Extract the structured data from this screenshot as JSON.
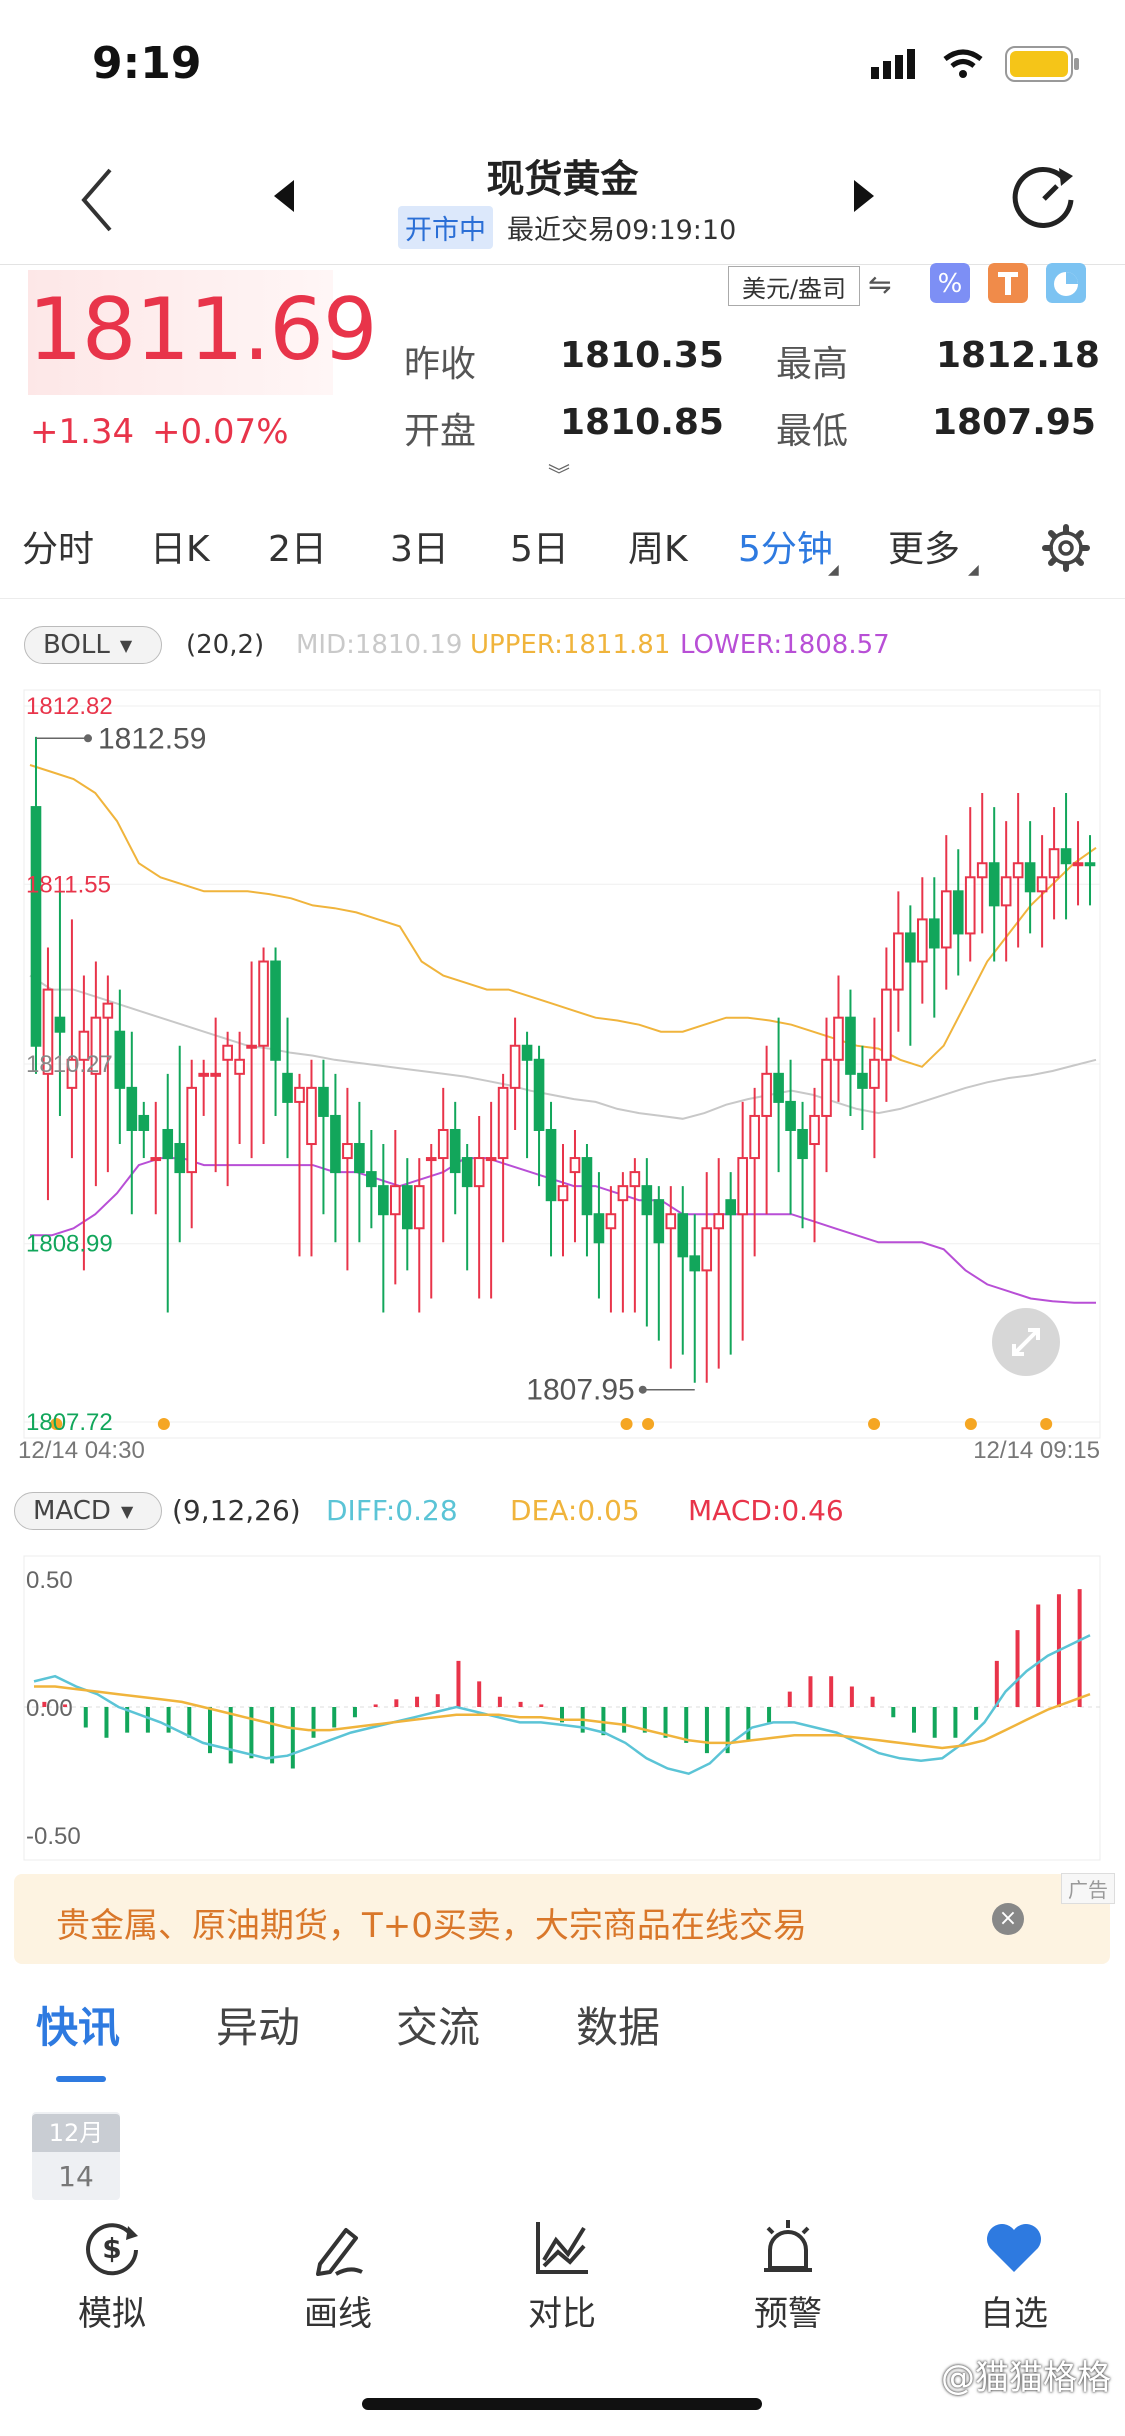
{
  "status": {
    "time": "9:19"
  },
  "header": {
    "title": "现货黄金",
    "status_badge": "开市中",
    "last_trade": "最近交易09:19:10"
  },
  "quote": {
    "price": "1811.69",
    "change": "+1.34",
    "change_pct": "+0.07%",
    "currency": "美元/盎司",
    "stats": [
      {
        "label": "昨收",
        "value": "1810.35"
      },
      {
        "label": "最高",
        "value": "1812.18"
      },
      {
        "label": "开盘",
        "value": "1810.85"
      },
      {
        "label": "最低",
        "value": "1807.95"
      }
    ]
  },
  "period_tabs": [
    "分时",
    "日K",
    "2日",
    "3日",
    "5日",
    "周K",
    "5分钟",
    "更多"
  ],
  "active_tab": "5分钟",
  "boll": {
    "name": "BOLL",
    "params": "(20,2)",
    "mid": "MID:1810.19",
    "upper": "UPPER:1811.81",
    "lower": "LOWER:1808.57"
  },
  "macd": {
    "name": "MACD",
    "params": "(9,12,26)",
    "diff": "DIFF:0.28",
    "dea": "DEA:0.05",
    "macd": "MACD:0.46"
  },
  "colors": {
    "up": "#e8344a",
    "down": "#12a65b",
    "mid_line": "#c8c8c8",
    "upper_line": "#f0b43c",
    "lower_line": "#b84fd6",
    "diff_line": "#5bc4d6",
    "dea_line": "#f0b43c",
    "accent": "#2e7ae0"
  },
  "chart_data": [
    {
      "type": "candlestick",
      "y_tick_labels": [
        "1812.82",
        "1811.55",
        "1810.27",
        "1808.99",
        "1807.72"
      ],
      "ylim": [
        1807.72,
        1812.82
      ],
      "x_start_label": "12/14 04:30",
      "x_end_label": "12/14 09:15",
      "high_label": "1812.59",
      "low_label": "1807.95",
      "candles": [
        [
          1812.1,
          1810.4,
          1810.2,
          1812.6
        ],
        [
          1810.2,
          1810.8,
          1809.3,
          1811.1
        ],
        [
          1810.6,
          1810.5,
          1809.9,
          1811.5
        ],
        [
          1810.1,
          1810.3,
          1809.6,
          1811.3
        ],
        [
          1810.3,
          1810.5,
          1808.8,
          1810.9
        ],
        [
          1810.2,
          1810.6,
          1809.4,
          1811.0
        ],
        [
          1810.6,
          1810.7,
          1809.5,
          1810.9
        ],
        [
          1810.5,
          1810.1,
          1809.7,
          1810.8
        ],
        [
          1810.1,
          1809.8,
          1809.2,
          1810.5
        ],
        [
          1809.9,
          1809.8,
          1809.6,
          1810.0
        ],
        [
          1809.6,
          1809.6,
          1809.2,
          1810.0
        ],
        [
          1809.8,
          1809.6,
          1808.5,
          1810.2
        ],
        [
          1809.7,
          1809.5,
          1809.0,
          1810.4
        ],
        [
          1809.5,
          1810.1,
          1809.1,
          1810.3
        ],
        [
          1810.2,
          1810.2,
          1809.9,
          1810.3
        ],
        [
          1810.2,
          1810.2,
          1809.5,
          1810.6
        ],
        [
          1810.3,
          1810.4,
          1809.4,
          1810.5
        ],
        [
          1810.2,
          1810.3,
          1809.7,
          1810.5
        ],
        [
          1810.4,
          1810.4,
          1809.6,
          1811.0
        ],
        [
          1810.4,
          1811.0,
          1809.7,
          1811.1
        ],
        [
          1811.0,
          1810.3,
          1809.9,
          1811.1
        ],
        [
          1810.2,
          1810.0,
          1809.6,
          1810.6
        ],
        [
          1810.0,
          1810.1,
          1808.9,
          1810.2
        ],
        [
          1809.7,
          1810.1,
          1808.9,
          1810.3
        ],
        [
          1810.1,
          1809.9,
          1809.2,
          1810.3
        ],
        [
          1809.9,
          1809.5,
          1809.0,
          1810.2
        ],
        [
          1809.6,
          1809.7,
          1808.8,
          1810.1
        ],
        [
          1809.7,
          1809.5,
          1809.0,
          1810.0
        ],
        [
          1809.5,
          1809.4,
          1809.1,
          1809.8
        ],
        [
          1809.4,
          1809.2,
          1808.5,
          1809.7
        ],
        [
          1809.2,
          1809.4,
          1808.7,
          1809.8
        ],
        [
          1809.4,
          1809.1,
          1808.8,
          1809.6
        ],
        [
          1809.1,
          1809.4,
          1808.5,
          1809.6
        ],
        [
          1809.6,
          1809.6,
          1808.6,
          1809.7
        ],
        [
          1809.6,
          1809.8,
          1809.0,
          1810.1
        ],
        [
          1809.8,
          1809.5,
          1809.2,
          1810.0
        ],
        [
          1809.6,
          1809.4,
          1808.8,
          1809.7
        ],
        [
          1809.4,
          1809.6,
          1808.6,
          1809.9
        ],
        [
          1809.6,
          1809.6,
          1808.6,
          1810.0
        ],
        [
          1809.6,
          1810.1,
          1809.0,
          1810.2
        ],
        [
          1810.1,
          1810.4,
          1809.8,
          1810.6
        ],
        [
          1810.4,
          1810.3,
          1809.6,
          1810.5
        ],
        [
          1810.3,
          1809.8,
          1809.4,
          1810.4
        ],
        [
          1809.8,
          1809.3,
          1808.9,
          1810.0
        ],
        [
          1809.3,
          1809.4,
          1808.9,
          1809.7
        ],
        [
          1809.5,
          1809.6,
          1809.0,
          1809.8
        ],
        [
          1809.6,
          1809.2,
          1808.9,
          1809.7
        ],
        [
          1809.2,
          1809.0,
          1808.6,
          1809.5
        ],
        [
          1809.1,
          1809.2,
          1808.5,
          1809.4
        ],
        [
          1809.3,
          1809.4,
          1808.5,
          1809.5
        ],
        [
          1809.4,
          1809.5,
          1808.5,
          1809.6
        ],
        [
          1809.4,
          1809.2,
          1808.4,
          1809.6
        ],
        [
          1809.3,
          1809.0,
          1808.3,
          1809.4
        ],
        [
          1809.1,
          1809.2,
          1808.1,
          1809.4
        ],
        [
          1809.2,
          1808.9,
          1808.2,
          1809.4
        ],
        [
          1808.9,
          1808.8,
          1808.0,
          1809.2
        ],
        [
          1808.8,
          1809.1,
          1808.0,
          1809.5
        ],
        [
          1809.1,
          1809.2,
          1808.1,
          1809.6
        ],
        [
          1809.3,
          1809.2,
          1808.2,
          1809.5
        ],
        [
          1809.2,
          1809.6,
          1808.3,
          1810.0
        ],
        [
          1809.6,
          1809.9,
          1808.9,
          1810.1
        ],
        [
          1809.9,
          1810.2,
          1809.2,
          1810.4
        ],
        [
          1810.2,
          1810.0,
          1809.5,
          1810.6
        ],
        [
          1810.0,
          1809.8,
          1809.2,
          1810.3
        ],
        [
          1809.8,
          1809.6,
          1809.1,
          1810.0
        ],
        [
          1809.7,
          1809.9,
          1809.0,
          1810.1
        ],
        [
          1809.9,
          1810.3,
          1809.5,
          1810.6
        ],
        [
          1810.3,
          1810.6,
          1810.0,
          1810.9
        ],
        [
          1810.6,
          1810.2,
          1809.9,
          1810.8
        ],
        [
          1810.2,
          1810.1,
          1809.8,
          1810.4
        ],
        [
          1810.1,
          1810.3,
          1809.6,
          1810.6
        ],
        [
          1810.3,
          1810.8,
          1810.0,
          1811.1
        ],
        [
          1810.8,
          1811.2,
          1810.5,
          1811.5
        ],
        [
          1811.2,
          1811.0,
          1810.4,
          1811.4
        ],
        [
          1811.0,
          1811.3,
          1810.7,
          1811.6
        ],
        [
          1811.3,
          1811.1,
          1810.6,
          1811.6
        ],
        [
          1811.1,
          1811.5,
          1810.8,
          1811.9
        ],
        [
          1811.5,
          1811.2,
          1810.9,
          1811.8
        ],
        [
          1811.2,
          1811.6,
          1811.0,
          1812.1
        ],
        [
          1811.6,
          1811.7,
          1811.2,
          1812.2
        ],
        [
          1811.7,
          1811.4,
          1811.0,
          1812.1
        ],
        [
          1811.4,
          1811.6,
          1811.0,
          1812.0
        ],
        [
          1811.6,
          1811.7,
          1811.1,
          1812.2
        ],
        [
          1811.7,
          1811.5,
          1811.2,
          1812.0
        ],
        [
          1811.5,
          1811.6,
          1811.1,
          1811.9
        ],
        [
          1811.6,
          1811.8,
          1811.3,
          1812.1
        ],
        [
          1811.8,
          1811.7,
          1811.3,
          1812.2
        ],
        [
          1811.7,
          1811.7,
          1811.4,
          1812.0
        ],
        [
          1811.7,
          1811.69,
          1811.4,
          1811.9
        ]
      ],
      "candles_note": "",
      "mid": [
        1810.9,
        1810.8,
        1810.8,
        1810.75,
        1810.7,
        1810.65,
        1810.6,
        1810.55,
        1810.5,
        1810.45,
        1810.4,
        1810.38,
        1810.35,
        1810.33,
        1810.3,
        1810.28,
        1810.26,
        1810.24,
        1810.22,
        1810.2,
        1810.18,
        1810.15,
        1810.12,
        1810.08,
        1810.05,
        1810.02,
        1810.0,
        1809.95,
        1809.92,
        1809.9,
        1809.88,
        1809.92,
        1809.98,
        1810.02,
        1810.05,
        1810.08,
        1810.05,
        1810.0,
        1809.95,
        1809.92,
        1809.95,
        1810.0,
        1810.05,
        1810.1,
        1810.14,
        1810.17,
        1810.19,
        1810.22,
        1810.26,
        1810.3
      ],
      "upper": [
        1812.4,
        1812.35,
        1812.3,
        1812.2,
        1812.0,
        1811.7,
        1811.6,
        1811.55,
        1811.5,
        1811.5,
        1811.5,
        1811.48,
        1811.45,
        1811.4,
        1811.38,
        1811.35,
        1811.3,
        1811.25,
        1811.0,
        1810.9,
        1810.85,
        1810.8,
        1810.8,
        1810.75,
        1810.7,
        1810.65,
        1810.6,
        1810.58,
        1810.55,
        1810.5,
        1810.5,
        1810.55,
        1810.6,
        1810.6,
        1810.58,
        1810.55,
        1810.5,
        1810.45,
        1810.4,
        1810.38,
        1810.3,
        1810.25,
        1810.4,
        1810.7,
        1811.0,
        1811.2,
        1811.4,
        1811.55,
        1811.7,
        1811.81
      ],
      "lower": [
        1809.05,
        1809.05,
        1809.1,
        1809.2,
        1809.35,
        1809.55,
        1809.6,
        1809.6,
        1809.55,
        1809.55,
        1809.55,
        1809.55,
        1809.55,
        1809.55,
        1809.5,
        1809.5,
        1809.45,
        1809.4,
        1809.45,
        1809.5,
        1809.6,
        1809.6,
        1809.55,
        1809.5,
        1809.45,
        1809.4,
        1809.4,
        1809.35,
        1809.3,
        1809.3,
        1809.2,
        1809.2,
        1809.2,
        1809.2,
        1809.2,
        1809.2,
        1809.15,
        1809.1,
        1809.05,
        1809.0,
        1809.0,
        1809.0,
        1808.95,
        1808.8,
        1808.7,
        1808.65,
        1808.6,
        1808.58,
        1808.57,
        1808.57
      ],
      "low_markers": [
        0.03,
        0.13,
        0.56,
        0.58,
        0.79,
        0.88,
        0.95
      ]
    },
    {
      "type": "bar+line",
      "y_tick_labels": [
        "0.50",
        "0.00",
        "-0.50"
      ],
      "ylim": [
        -0.55,
        0.55
      ],
      "macd_hist": [
        0.02,
        0.01,
        -0.08,
        -0.12,
        -0.1,
        -0.1,
        -0.1,
        -0.12,
        -0.18,
        -0.22,
        -0.2,
        -0.22,
        -0.24,
        -0.12,
        -0.08,
        -0.04,
        0.01,
        0.03,
        0.04,
        0.05,
        0.18,
        0.1,
        0.04,
        0.02,
        0.01,
        -0.06,
        -0.1,
        -0.11,
        -0.1,
        -0.1,
        -0.12,
        -0.14,
        -0.18,
        -0.18,
        -0.13,
        -0.06,
        0.06,
        0.12,
        0.12,
        0.08,
        0.04,
        -0.04,
        -0.1,
        -0.12,
        -0.12,
        -0.05,
        0.18,
        0.3,
        0.4,
        0.44,
        0.46
      ],
      "diff": [
        0.1,
        0.12,
        0.08,
        0.05,
        0.0,
        -0.03,
        -0.06,
        -0.1,
        -0.14,
        -0.16,
        -0.18,
        -0.2,
        -0.19,
        -0.16,
        -0.13,
        -0.1,
        -0.08,
        -0.06,
        -0.04,
        -0.02,
        0.0,
        -0.02,
        -0.04,
        -0.06,
        -0.06,
        -0.07,
        -0.08,
        -0.1,
        -0.14,
        -0.2,
        -0.24,
        -0.26,
        -0.22,
        -0.14,
        -0.08,
        -0.06,
        -0.06,
        -0.08,
        -0.1,
        -0.14,
        -0.18,
        -0.2,
        -0.21,
        -0.2,
        -0.14,
        -0.06,
        0.06,
        0.14,
        0.2,
        0.24,
        0.28
      ],
      "dea": [
        0.08,
        0.08,
        0.07,
        0.06,
        0.05,
        0.04,
        0.03,
        0.02,
        0.0,
        -0.02,
        -0.04,
        -0.06,
        -0.08,
        -0.09,
        -0.09,
        -0.08,
        -0.07,
        -0.06,
        -0.05,
        -0.04,
        -0.03,
        -0.03,
        -0.03,
        -0.04,
        -0.04,
        -0.05,
        -0.05,
        -0.06,
        -0.07,
        -0.09,
        -0.11,
        -0.13,
        -0.14,
        -0.14,
        -0.13,
        -0.12,
        -0.11,
        -0.11,
        -0.11,
        -0.12,
        -0.13,
        -0.14,
        -0.15,
        -0.16,
        -0.15,
        -0.13,
        -0.09,
        -0.05,
        -0.01,
        0.02,
        0.05
      ]
    }
  ],
  "ad": {
    "text": "贵金属、原油期货，T+0买卖，大宗商品在线交易",
    "tag": "广告"
  },
  "news_tabs": [
    "快讯",
    "异动",
    "交流",
    "数据"
  ],
  "date_chip": {
    "month": "12月",
    "day": "14"
  },
  "bottom_nav": [
    "模拟",
    "画线",
    "对比",
    "预警",
    "自选"
  ],
  "watermark": "@猫猫格格"
}
